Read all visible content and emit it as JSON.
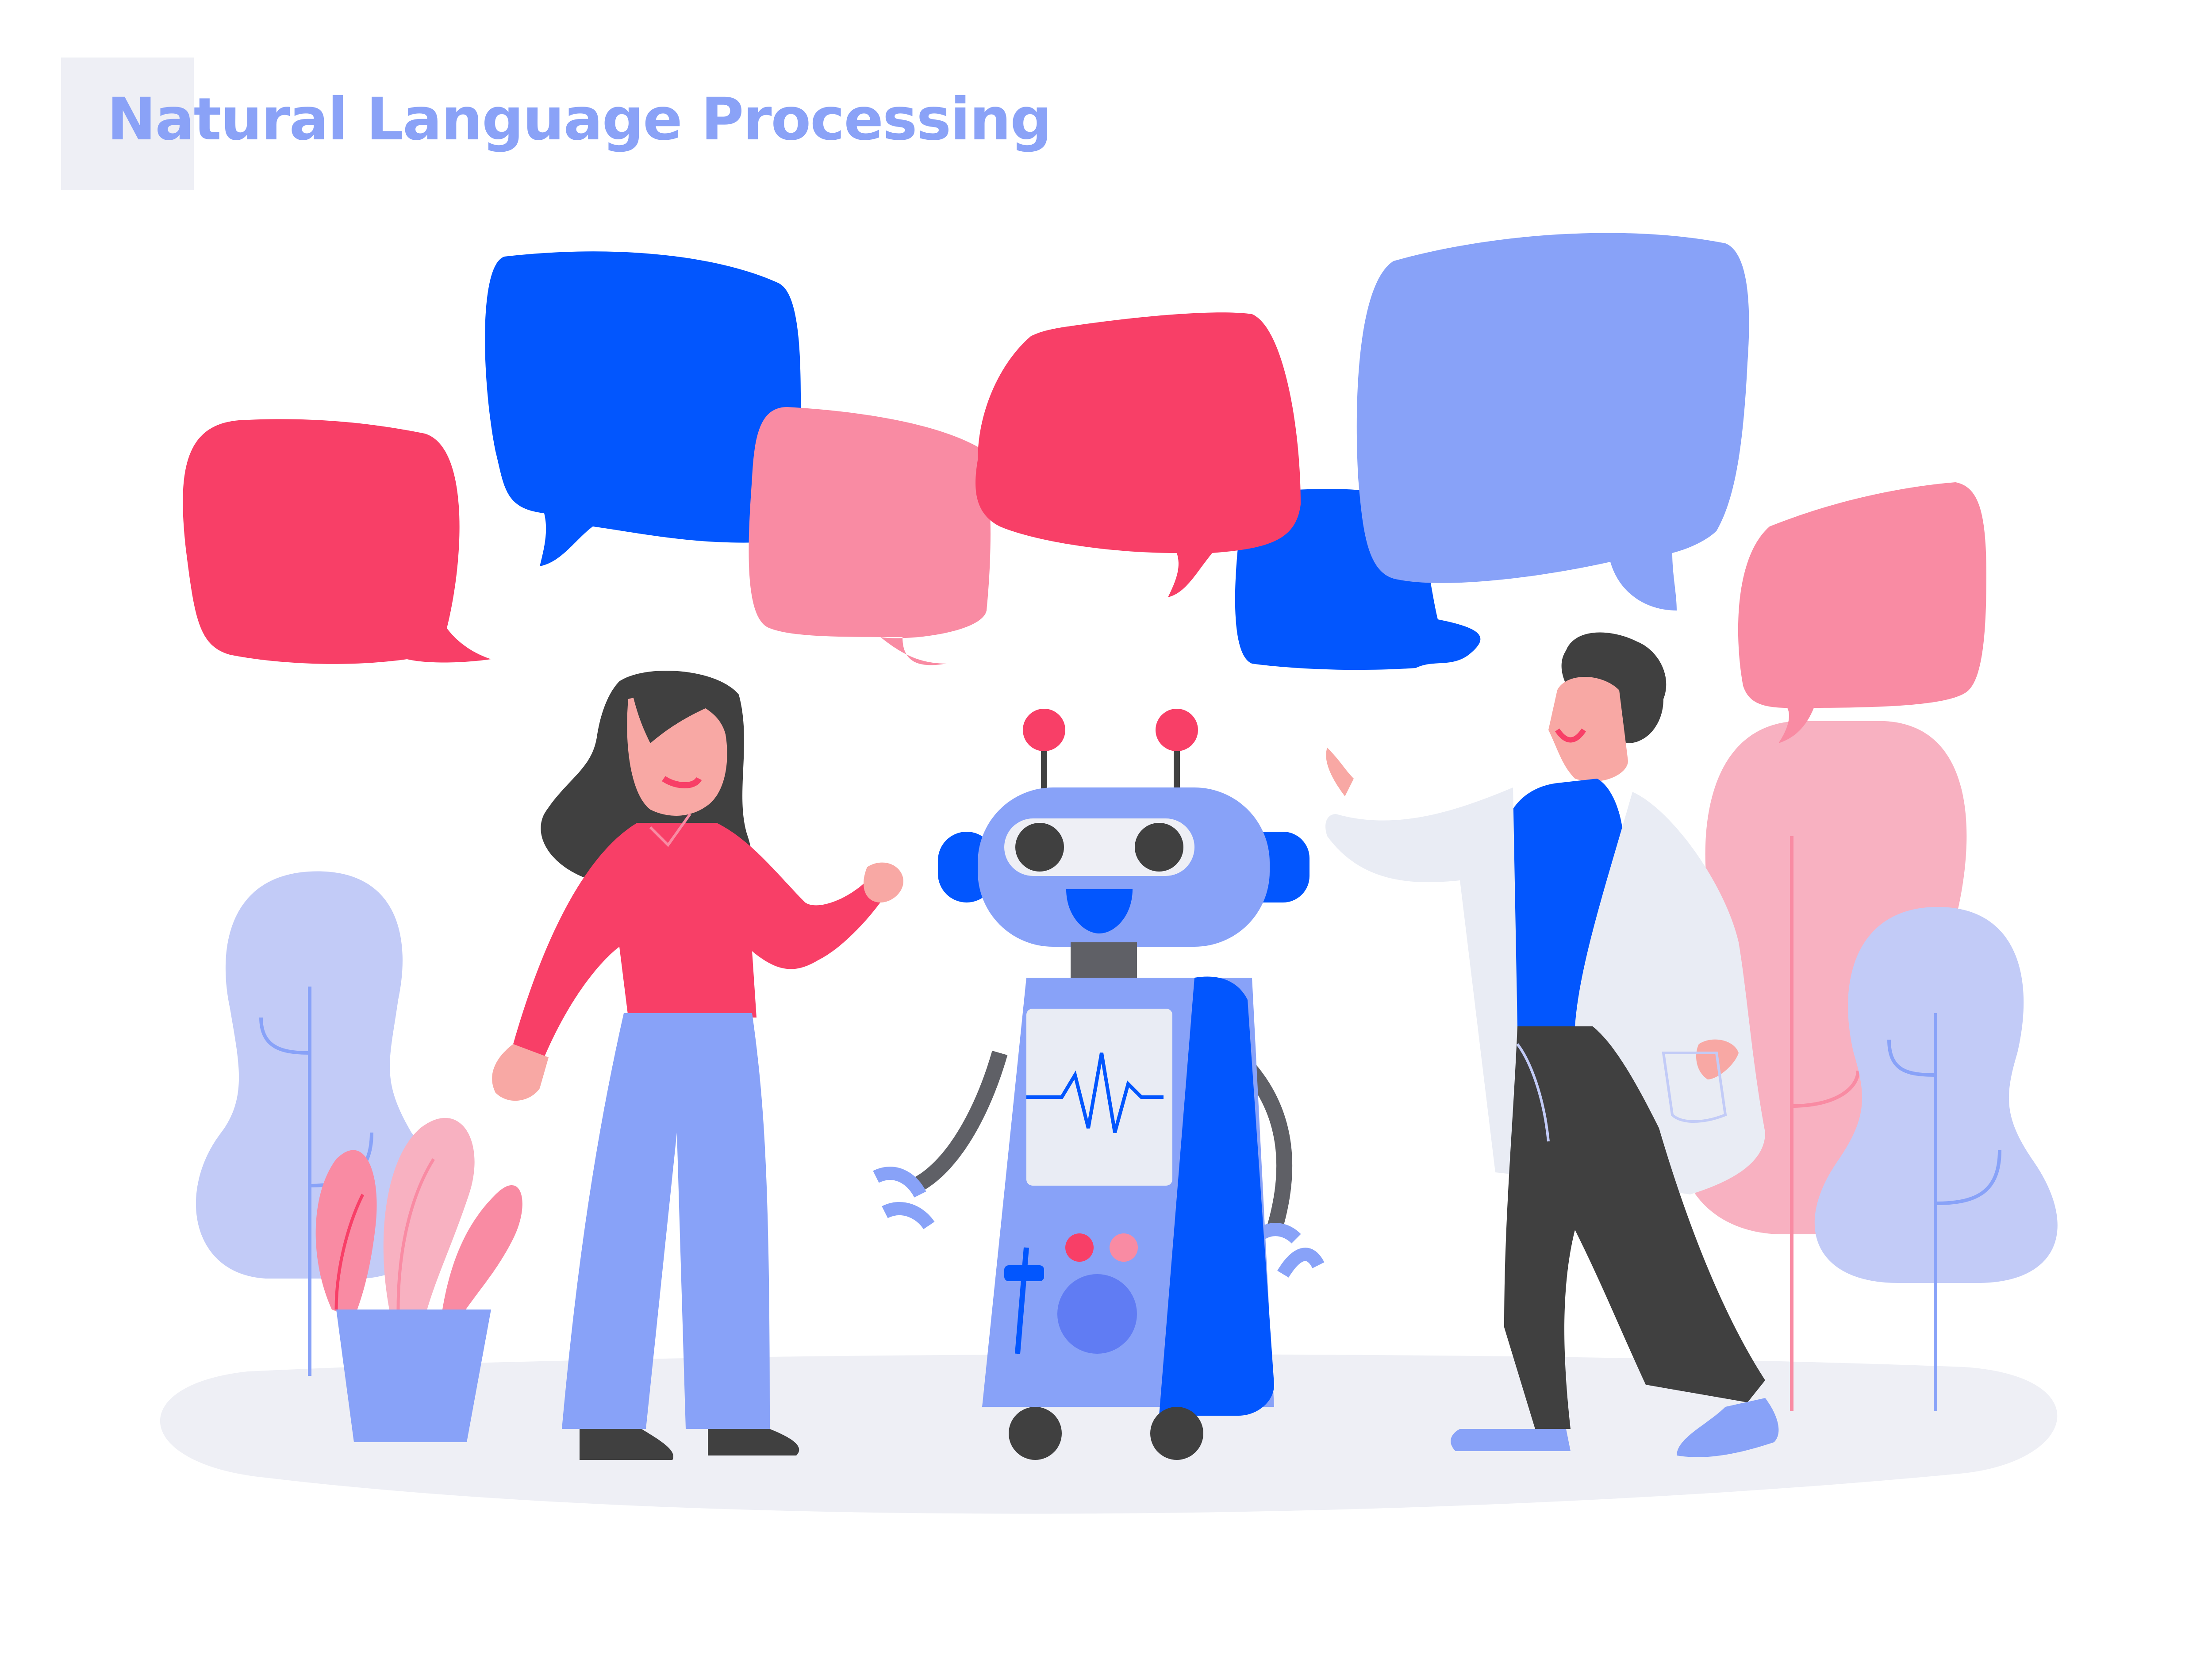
{
  "title": {
    "text": "Natural Language Processing"
  },
  "colors": {
    "title": "#8aa2f7",
    "title_block": "#eeeff5",
    "floor": "#eeeff5",
    "pink_red": "#f83f67",
    "light_pink": "#f98ba3",
    "pale_pink": "#f8b1c1",
    "blue": "#0256fe",
    "periwinkle": "#88a2f8",
    "pale_periwinkle": "#c2cbf7",
    "dark_gray": "#404040",
    "skin": "#f8a8a4",
    "coat": "#e9ecf4"
  },
  "icons": [
    "speech-bubble-icon",
    "robot-icon",
    "woman-character-icon",
    "doctor-character-icon",
    "tree-icon",
    "potted-plant-icon"
  ]
}
